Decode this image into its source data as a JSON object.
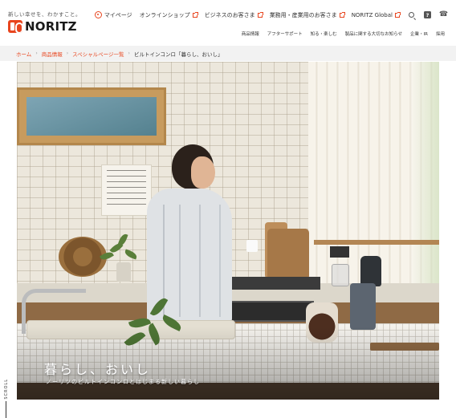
{
  "header": {
    "tagline": "新しい幸せを、わかすこと。",
    "logo_text": "NORITZ",
    "nav": [
      {
        "label": "マイページ"
      },
      {
        "label": "オンラインショップ"
      },
      {
        "label": "ビジネスのお客さま"
      },
      {
        "label": "業務用・産業用のお客さま"
      },
      {
        "label": "NORITZ Global"
      }
    ],
    "icons": [
      "search-icon",
      "help-icon",
      "phone-icon"
    ],
    "subnav": [
      "商品情報",
      "アフターサポート",
      "知る・楽しむ",
      "製品に関する大切なお知らせ",
      "企業・IR",
      "採用"
    ]
  },
  "breadcrumb": {
    "items": [
      "ホーム",
      "商品情報",
      "スペシャルページ一覧"
    ],
    "current": "ビルトインコンロ「暮らし、おいし」"
  },
  "hero": {
    "title": "暮らし、おいし",
    "subtitle": "ノーリツのビルトインコンロとはじまる新しい暮らし"
  },
  "scroll_label": "SCROLL",
  "colors": {
    "accent": "#e8451e",
    "breadcrumb_bg": "#f2f2f2"
  }
}
